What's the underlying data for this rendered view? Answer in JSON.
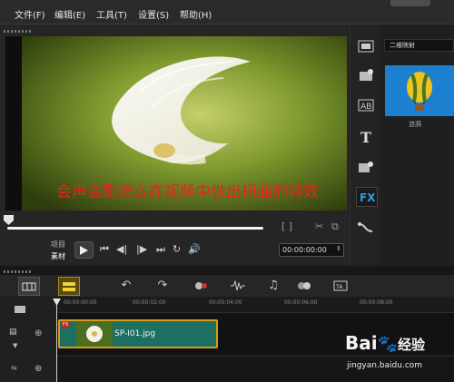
{
  "menubar": {
    "items": [
      "文件(F)",
      "编辑(E)",
      "工具(T)",
      "设置(S)",
      "帮助(H)"
    ]
  },
  "preview": {
    "caption": "会声会影怎么在视频中做出扭曲的特效",
    "mode_labels": [
      "项目",
      "素材"
    ],
    "timecode": "00:00:00:00",
    "bracket_controls": "[ ]"
  },
  "library": {
    "category": "二维映射",
    "thumbnail_label": "涟漪"
  },
  "timeline": {
    "ruler_ticks": [
      "00:00:00:00",
      "00:00:02:00",
      "00:00:04:00",
      "00:00:06:00",
      "00:00:08:00"
    ],
    "clip": {
      "name": "SP-I01.jpg",
      "fx_badge": "FX"
    }
  },
  "watermark": {
    "brand": "Bai",
    "brand_suffix": "经验",
    "url": "jingyan.baidu.com"
  },
  "colors": {
    "caption": "#e8231c",
    "clip_fill": "#1d6f62",
    "clip_border": "#d99a1a",
    "thumbnail_bg": "#1d7fd0"
  },
  "icons": [
    "play-icon",
    "fx-icon",
    "text-icon",
    "transition-icon",
    "undo-icon",
    "redo-icon",
    "storyboard-icon",
    "timeline-icon"
  ]
}
